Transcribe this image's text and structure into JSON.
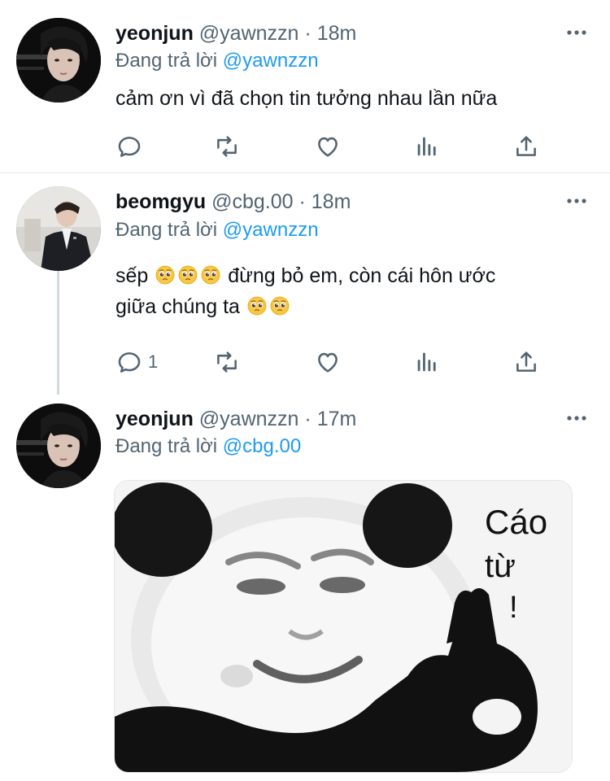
{
  "tweets": [
    {
      "name": "yeonjun",
      "handle": "@yawnzzn",
      "sep": "·",
      "time": "18m",
      "reply_prefix": "Đang trả lời",
      "reply_to": "@yawnzzn",
      "text": "cảm ơn vì đã chọn tin tưởng nhau lần nữa",
      "reply_count": ""
    },
    {
      "name": "beomgyu",
      "handle": "@cbg.00",
      "sep": "·",
      "time": "18m",
      "reply_prefix": "Đang trả lời",
      "reply_to": "@yawnzzn",
      "text_line1": "sếp",
      "text_line1b": " đừng bỏ em, còn cái hôn ước",
      "text_line2": "giữa chúng ta",
      "reply_count": "1"
    },
    {
      "name": "yeonjun",
      "handle": "@yawnzzn",
      "sep": "·",
      "time": "17m",
      "reply_prefix": "Đang trả lời",
      "reply_to": "@cbg.00",
      "media_text_line1": "Cáo",
      "media_text_line2": "từ",
      "media_text_line3": "!"
    }
  ],
  "icons": {
    "reply": "reply-icon",
    "retweet": "retweet-icon",
    "like": "heart-icon",
    "views": "views-icon",
    "share": "share-icon",
    "more": "more-icon",
    "emoji": "pleading-face-emoji"
  },
  "colors": {
    "link": "#1d9bf0",
    "secondary": "#536471",
    "text": "#0f1419"
  }
}
